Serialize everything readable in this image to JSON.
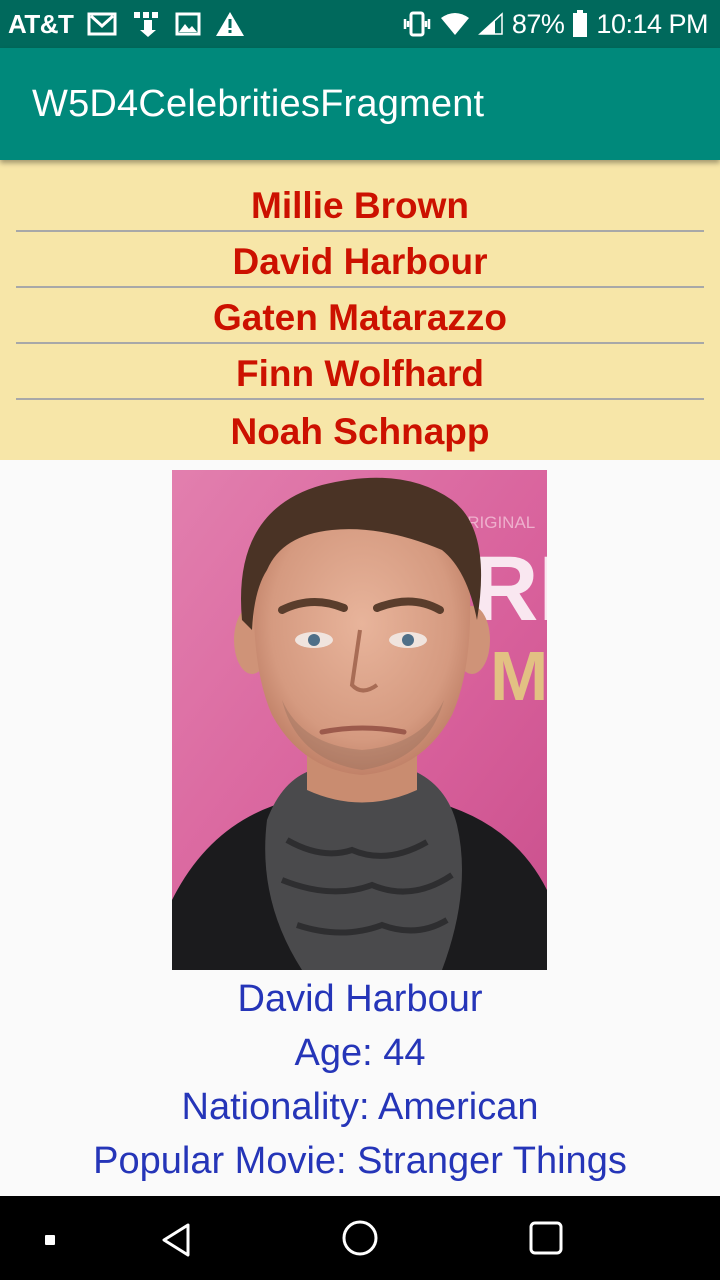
{
  "status_bar": {
    "carrier": "AT&T",
    "battery": "87%",
    "time": "10:14 PM",
    "icons": [
      "gmail-icon",
      "notification-icon",
      "image-icon",
      "warning-icon",
      "vibrate-icon",
      "wifi-icon",
      "signal-icon",
      "battery-icon"
    ]
  },
  "app_bar": {
    "title": "W5D4CelebritiesFragment"
  },
  "celebrity_list": {
    "items": [
      "Millie Brown",
      "David Harbour",
      "Gaten Matarazzo",
      "Finn Wolfhard",
      "Noah Schnapp"
    ]
  },
  "detail": {
    "name": "David Harbour",
    "age": "Age: 44",
    "nationality": "Nationality: American",
    "popular_movie": "Popular Movie: Stranger Things",
    "poster_text": [
      "ORIGINAL",
      "RE",
      "MY"
    ]
  },
  "nav_bar": {
    "icons": [
      "recent-apps-icon",
      "back-icon",
      "home-icon",
      "overview-icon"
    ]
  },
  "colors": {
    "status_bar": "#00695c",
    "app_bar": "#00897b",
    "list_bg": "#f7e6a8",
    "list_text": "#cc1100",
    "detail_text": "#2535b8"
  }
}
